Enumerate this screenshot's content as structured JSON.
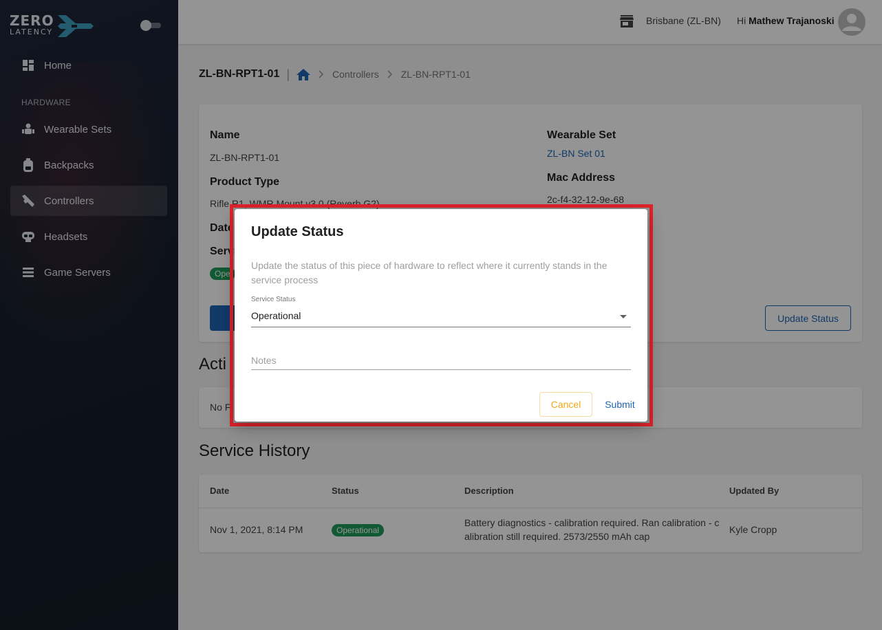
{
  "brand": {
    "line1": "ZERO",
    "line2": "LATENCY"
  },
  "sidebar": {
    "section": "HARDWARE",
    "items": [
      {
        "label": "Home",
        "icon": "dashboard-icon"
      },
      {
        "label": "Wearable Sets",
        "icon": "wearable-icon"
      },
      {
        "label": "Backpacks",
        "icon": "backpack-icon"
      },
      {
        "label": "Controllers",
        "icon": "controller-icon",
        "active": true
      },
      {
        "label": "Headsets",
        "icon": "headset-icon"
      },
      {
        "label": "Game Servers",
        "icon": "server-icon"
      }
    ]
  },
  "topbar": {
    "location": "Brisbane (ZL-BN)",
    "greeting_prefix": "Hi ",
    "user_name": "Mathew Trajanoski"
  },
  "breadcrumb": {
    "title": "ZL-BN-RPT1-01",
    "items": [
      "Controllers",
      "ZL-BN-RPT1-01"
    ]
  },
  "details": {
    "name_label": "Name",
    "name_value": "ZL-BN-RPT1-01",
    "product_type_label": "Product Type",
    "product_type_value": "Rifle R1, WMR Mount v3.0 (Reverb G2)",
    "date_label_partial": "Date",
    "service_label_partial": "Servi",
    "status_badge_partial": "Ope",
    "wearable_set_label": "Wearable Set",
    "wearable_set_value": "ZL-BN Set 01",
    "mac_label": "Mac Address",
    "mac_value": "2c-f4-32-12-9e-68",
    "update_status_button": "Update Status"
  },
  "active_section": {
    "title_partial": "Acti",
    "empty_partial": "No F"
  },
  "service_history": {
    "title": "Service History",
    "columns": [
      "Date",
      "Status",
      "Description",
      "Updated By"
    ],
    "rows": [
      {
        "date": "Nov 1, 2021, 8:14 PM",
        "status": "Operational",
        "description_line1": "Battery diagnostics - calibration required. Ran calibration - c",
        "description_line2": "alibration still required. 2573/2550 mAh cap",
        "updated_by": "Kyle Cropp"
      }
    ]
  },
  "dialog": {
    "title": "Update Status",
    "description": "Update the status of this piece of hardware to reflect where it currently stands in the service process",
    "select_label": "Service Status",
    "select_value": "Operational",
    "notes_placeholder": "Notes",
    "cancel": "Cancel",
    "submit": "Submit"
  },
  "colors": {
    "accent": "#1e64b4",
    "success": "#1e9b5a",
    "warning": "#f0a818",
    "highlight": "#e0232b"
  }
}
